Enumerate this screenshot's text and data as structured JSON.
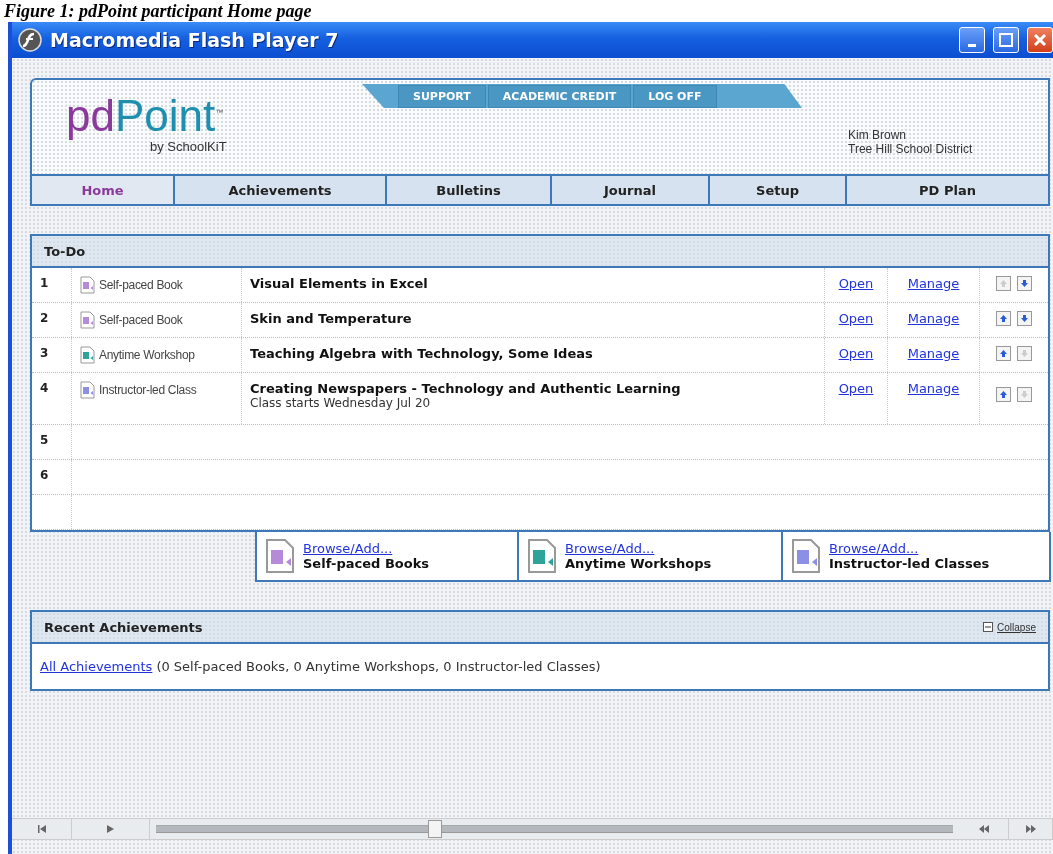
{
  "caption": "Figure 1: pdPoint participant Home page",
  "window": {
    "title": "Macromedia Flash Player 7"
  },
  "header": {
    "logo": {
      "part1": "pd",
      "part2": "Point",
      "tm": "™",
      "byline": "by SchoolKiT"
    },
    "top_links": [
      {
        "label": "SUPPORT"
      },
      {
        "label": "ACADEMIC CREDIT"
      },
      {
        "label": "LOG OFF"
      }
    ],
    "user": {
      "name": "Kim Brown",
      "district": "Tree Hill School District"
    }
  },
  "nav": [
    {
      "label": "Home",
      "selected": true
    },
    {
      "label": "Achievements",
      "selected": false
    },
    {
      "label": "Bulletins",
      "selected": false
    },
    {
      "label": "Journal",
      "selected": false
    },
    {
      "label": "Setup",
      "selected": false
    },
    {
      "label": "PD Plan",
      "selected": false
    }
  ],
  "todo": {
    "title": "To-Do",
    "rows": [
      {
        "number": "1",
        "type": "Self-paced Book",
        "kind": "book",
        "title": "Visual Elements in Excel",
        "open": "Open",
        "manage": "Manage",
        "up_disabled": true,
        "down_disabled": false
      },
      {
        "number": "2",
        "type": "Self-paced Book",
        "kind": "book",
        "title": "Skin and Temperature",
        "open": "Open",
        "manage": "Manage",
        "up_disabled": false,
        "down_disabled": false
      },
      {
        "number": "3",
        "type": "Anytime Workshop",
        "kind": "workshop",
        "title": "Teaching Algebra with Technology, Some Ideas",
        "open": "Open",
        "manage": "Manage",
        "up_disabled": false,
        "down_disabled": true
      },
      {
        "number": "4",
        "type": "Instructor-led Class",
        "kind": "class",
        "title": "Creating Newspapers - Technology and Authentic Learning",
        "subtitle": "Class starts Wednesday Jul 20",
        "open": "Open",
        "manage": "Manage",
        "up_disabled": false,
        "down_disabled": true
      },
      {
        "number": "5"
      },
      {
        "number": "6"
      }
    ]
  },
  "browse": [
    {
      "link": "Browse/Add...",
      "label": "Self-paced Books",
      "kind": "book"
    },
    {
      "link": "Browse/Add...",
      "label": "Anytime Workshops",
      "kind": "workshop"
    },
    {
      "link": "Browse/Add...",
      "label": "Instructor-led Classes",
      "kind": "class"
    }
  ],
  "recent": {
    "title": "Recent Achievements",
    "collapse": "Collapse",
    "link": "All Achievements",
    "summary": "(0 Self-paced Books, 0 Anytime Workshops, 0 Instructor-led Classes)"
  },
  "player": {
    "level": 0.35
  }
}
